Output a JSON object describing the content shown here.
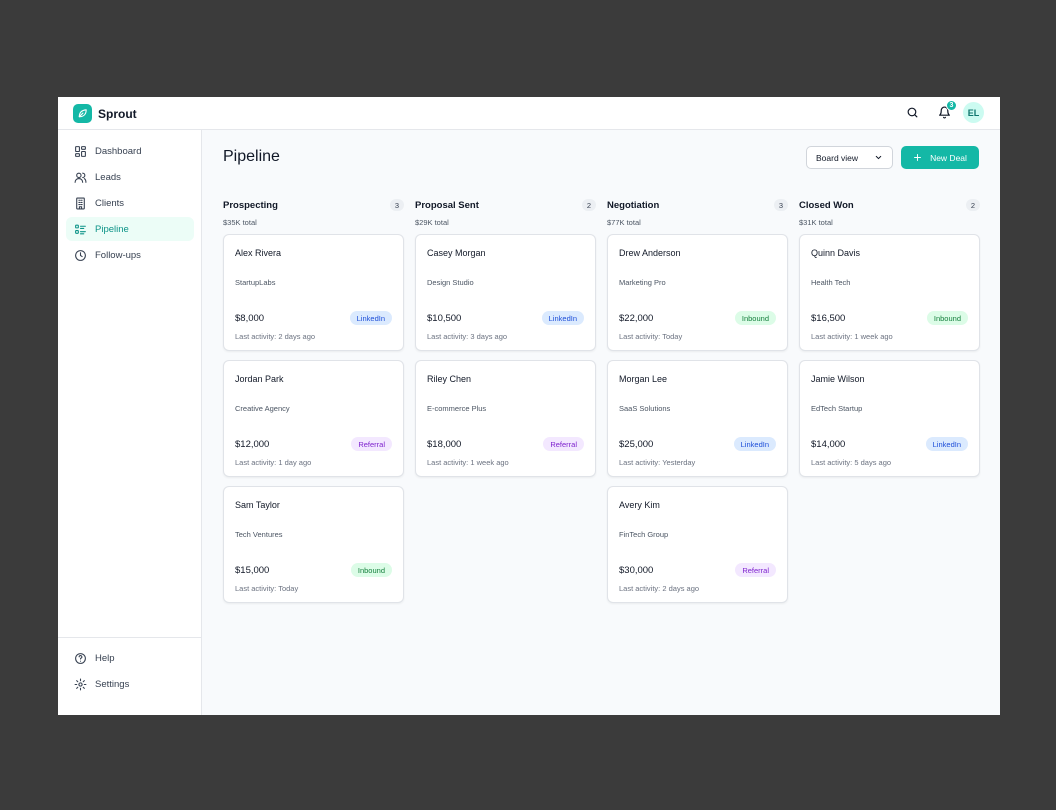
{
  "app": {
    "name": "Sprout"
  },
  "topbar": {
    "notification_count": "3",
    "avatar_initials": "EL"
  },
  "sidebar": {
    "items": [
      {
        "label": "Dashboard",
        "icon": "dashboard-icon"
      },
      {
        "label": "Leads",
        "icon": "users-icon"
      },
      {
        "label": "Clients",
        "icon": "building-icon"
      },
      {
        "label": "Pipeline",
        "icon": "list-icon",
        "active": true
      },
      {
        "label": "Follow-ups",
        "icon": "clock-icon"
      }
    ],
    "bottom": [
      {
        "label": "Help",
        "icon": "help-icon"
      },
      {
        "label": "Settings",
        "icon": "gear-icon"
      }
    ]
  },
  "main": {
    "title": "Pipeline",
    "view_select": "Board view",
    "new_deal_label": "New Deal",
    "columns": [
      {
        "title": "Prospecting",
        "count": "3",
        "total": "$35K total",
        "cards": [
          {
            "name": "Alex Rivera",
            "company": "StartupLabs",
            "value": "$8,000",
            "source": "LinkedIn",
            "activity": "Last activity: 2 days ago"
          },
          {
            "name": "Jordan Park",
            "company": "Creative Agency",
            "value": "$12,000",
            "source": "Referral",
            "activity": "Last activity: 1 day ago"
          },
          {
            "name": "Sam Taylor",
            "company": "Tech Ventures",
            "value": "$15,000",
            "source": "Inbound",
            "activity": "Last activity: Today"
          }
        ]
      },
      {
        "title": "Proposal Sent",
        "count": "2",
        "total": "$29K total",
        "cards": [
          {
            "name": "Casey Morgan",
            "company": "Design Studio",
            "value": "$10,500",
            "source": "LinkedIn",
            "activity": "Last activity: 3 days ago"
          },
          {
            "name": "Riley Chen",
            "company": "E-commerce Plus",
            "value": "$18,000",
            "source": "Referral",
            "activity": "Last activity: 1 week ago"
          }
        ]
      },
      {
        "title": "Negotiation",
        "count": "3",
        "total": "$77K total",
        "cards": [
          {
            "name": "Drew Anderson",
            "company": "Marketing Pro",
            "value": "$22,000",
            "source": "Inbound",
            "activity": "Last activity: Today"
          },
          {
            "name": "Morgan Lee",
            "company": "SaaS Solutions",
            "value": "$25,000",
            "source": "LinkedIn",
            "activity": "Last activity: Yesterday"
          },
          {
            "name": "Avery Kim",
            "company": "FinTech Group",
            "value": "$30,000",
            "source": "Referral",
            "activity": "Last activity: 2 days ago"
          }
        ]
      },
      {
        "title": "Closed Won",
        "count": "2",
        "total": "$31K total",
        "cards": [
          {
            "name": "Quinn Davis",
            "company": "Health Tech",
            "value": "$16,500",
            "source": "Inbound",
            "activity": "Last activity: 1 week ago"
          },
          {
            "name": "Jamie Wilson",
            "company": "EdTech Startup",
            "value": "$14,000",
            "source": "LinkedIn",
            "activity": "Last activity: 5 days ago"
          }
        ]
      }
    ]
  },
  "colors": {
    "accent": "#14b8a6",
    "linkedin_tag": "#dbeafe",
    "referral_tag": "#f3e8ff",
    "inbound_tag": "#dcfce7"
  }
}
